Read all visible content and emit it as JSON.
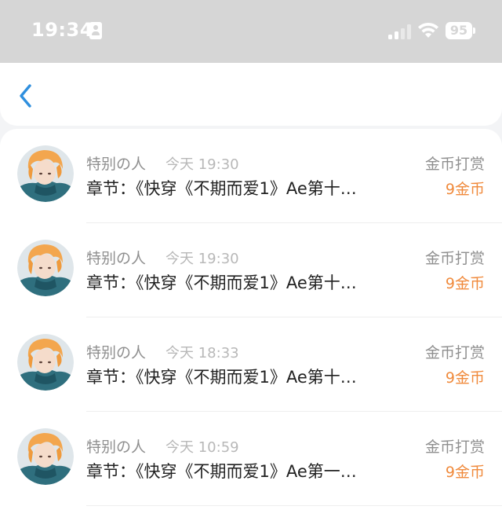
{
  "status_bar": {
    "time": "19:34",
    "battery": "95",
    "icons": [
      "id-card-icon",
      "cellular-signal-icon",
      "wifi-icon",
      "battery-icon"
    ]
  },
  "nav": {
    "back_icon": "chevron-left-icon",
    "accent_color": "#2f8fde"
  },
  "records": [
    {
      "name": "特别の人",
      "time": "今天 19:30",
      "chapter": "章节：《快穿《不期而爱1》Ae第十…",
      "type": "金币打赏",
      "amount": "9金币"
    },
    {
      "name": "特别の人",
      "time": "今天 19:30",
      "chapter": "章节：《快穿《不期而爱1》Ae第十…",
      "type": "金币打赏",
      "amount": "9金币"
    },
    {
      "name": "特别の人",
      "time": "今天 18:33",
      "chapter": "章节：《快穿《不期而爱1》Ae第十…",
      "type": "金币打赏",
      "amount": "9金币"
    },
    {
      "name": "特别の人",
      "time": "今天 10:59",
      "chapter": "章节：《快穿《不期而爱1》Ae第一…",
      "type": "金币打赏",
      "amount": "9金币"
    }
  ],
  "colors": {
    "amount": "#f08a3c",
    "status_bar_bg": "#d6d6d6"
  }
}
